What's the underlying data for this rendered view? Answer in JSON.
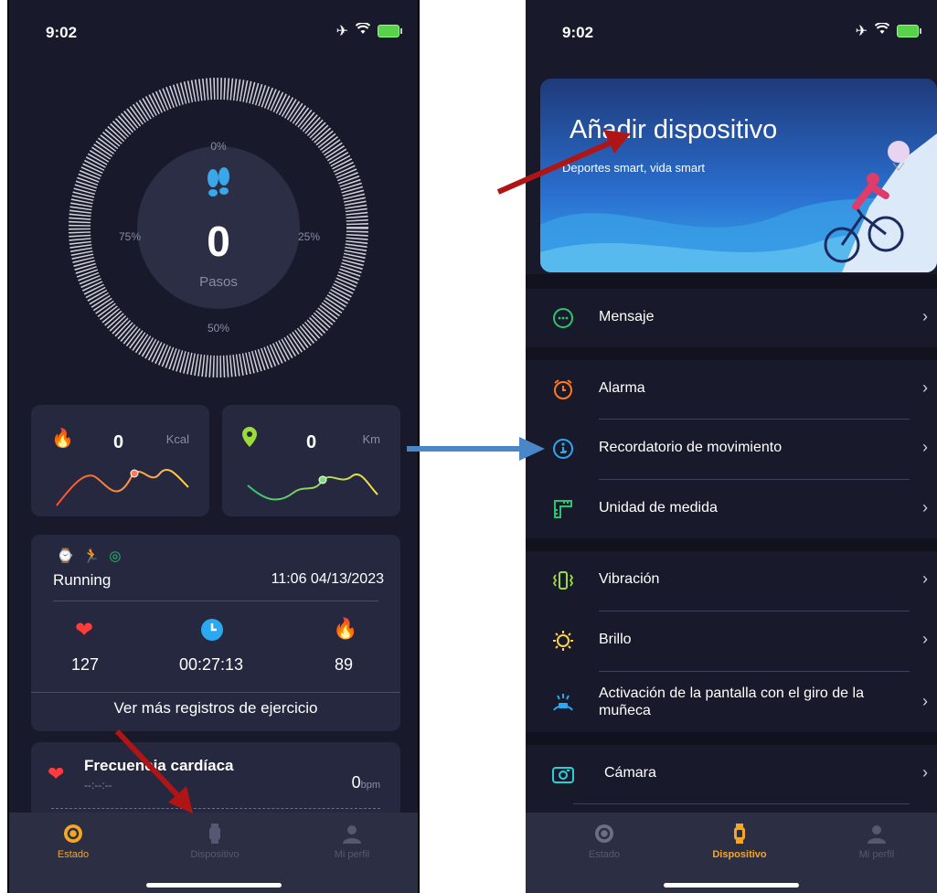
{
  "left": {
    "status_time": "9:02",
    "ring": {
      "p0": "0%",
      "p25": "25%",
      "p50": "50%",
      "p75": "75%",
      "steps_value": "0",
      "steps_label": "Pasos"
    },
    "kcal": {
      "value": "0",
      "unit": "Kcal"
    },
    "km": {
      "value": "0",
      "unit": "Km"
    },
    "exercise": {
      "type": "Running",
      "datetime": "11:06 04/13/2023",
      "heart": "127",
      "duration": "00:27:13",
      "calories": "89",
      "more_link": "Ver más registros de ejercicio"
    },
    "heart_rate": {
      "title": "Frecuencia cardíaca",
      "time": "--:--:--",
      "value": "0",
      "unit": "bpm"
    },
    "tabs": [
      {
        "label": "Estado",
        "color": "#f5a623"
      },
      {
        "label": "Dispositivo",
        "color": "#555870"
      },
      {
        "label": "Mi perfil",
        "color": "#555870"
      }
    ]
  },
  "right": {
    "status_time": "9:02",
    "banner": {
      "title": "Añadir dispositivo",
      "subtitle": "Deportes smart, vida smart"
    },
    "menu": [
      {
        "label": "Mensaje",
        "icon": "message-icon"
      },
      {
        "label": "Alarma",
        "icon": "alarm-icon"
      },
      {
        "label": "Recordatorio de movimiento",
        "icon": "movement-reminder-icon"
      },
      {
        "label": "Unidad de medida",
        "icon": "ruler-icon"
      },
      {
        "label": "Vibración",
        "icon": "vibration-icon"
      },
      {
        "label": "Brillo",
        "icon": "brightness-icon"
      },
      {
        "label": "Activación de la pantalla con el giro de la muñeca",
        "icon": "wrist-raise-icon"
      },
      {
        "label": "Cámara",
        "icon": "camera-icon"
      }
    ],
    "tabs": [
      {
        "label": "Estado"
      },
      {
        "label": "Dispositivo"
      },
      {
        "label": "Mi perfil"
      }
    ]
  },
  "colors": {
    "accent_orange": "#f5a623",
    "background": "#181a2b",
    "card": "#25283f",
    "arrow_red": "#b01515",
    "arrow_blue": "#4a86c8"
  }
}
